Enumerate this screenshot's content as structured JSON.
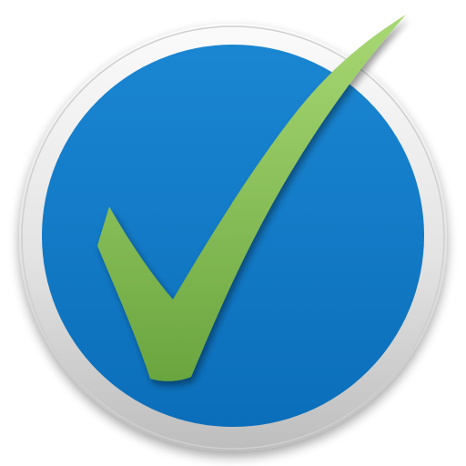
{
  "icon": {
    "name": "checkmark-badge-icon",
    "colors": {
      "ring_light": "#fbfbfb",
      "ring_mid": "#e3e3e3",
      "ring_dark": "#bdbdbd",
      "disc_top": "#1a86d2",
      "disc_bottom": "#0b6eba",
      "check_light": "#a8d873",
      "check_dark": "#6aa53f",
      "shadow": "#7a7a7a"
    }
  }
}
